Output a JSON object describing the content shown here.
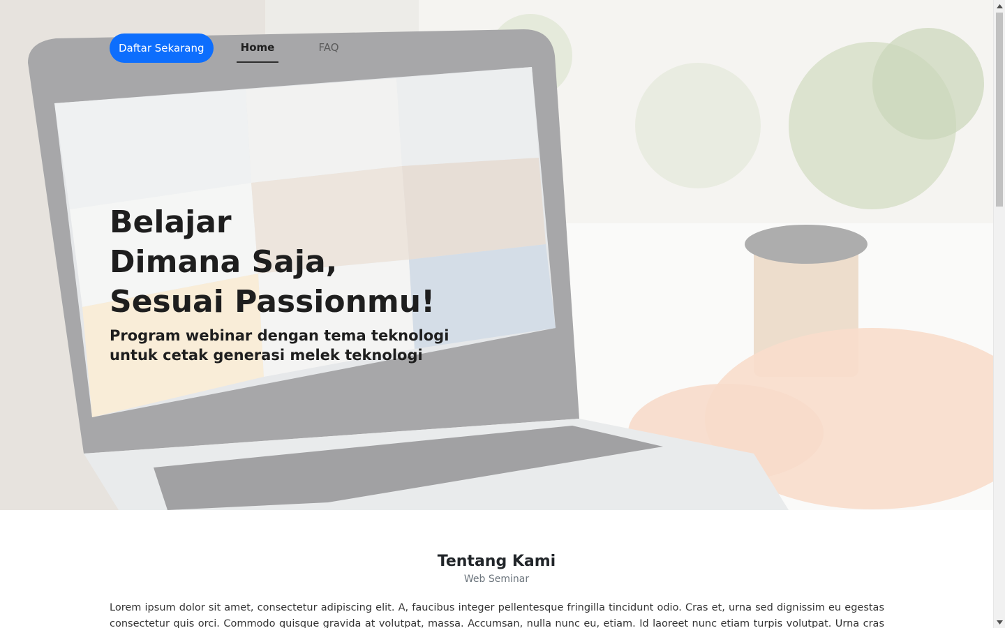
{
  "nav": {
    "register_label": "Daftar Sekarang",
    "home_label": "Home",
    "faq_label": "FAQ",
    "active_item": "Home"
  },
  "hero": {
    "title_lines": [
      "Belajar",
      "Dimana Saja,",
      "Sesuai Passionmu!"
    ],
    "subtitle_lines": [
      "Program webinar dengan tema teknologi",
      "untuk cetak generasi melek teknologi"
    ],
    "background_image": "laptop-video-conference-photo"
  },
  "about": {
    "title": "Tentang Kami",
    "subtitle": "Web Seminar",
    "paragraph": "Lorem ipsum dolor sit amet, consectetur adipiscing elit. A, faucibus integer pellentesque fringilla tincidunt odio. Cras et, urna sed dignissim eu egestas consectetur quis orci. Commodo quisque gravida at volutpat, massa. Accumsan, nulla nunc eu, etiam. Id laoreet nunc etiam turpis volutpat. Urna cras platea"
  },
  "scrollbar": {
    "up_icon": "triangle-up-icon",
    "down_icon": "triangle-down-icon"
  },
  "colors": {
    "primary": "#0d6efd",
    "heading": "#1e1e1e",
    "muted": "#6c757d",
    "background": "#ffffff"
  }
}
